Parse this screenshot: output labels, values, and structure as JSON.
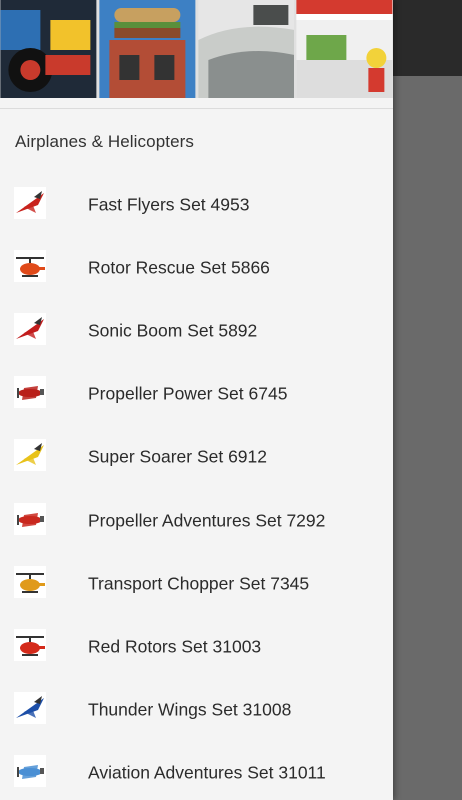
{
  "drawer": {
    "header_tiles": [
      {
        "name": "lego-vehicle-tile",
        "colors": [
          "#1f2a38",
          "#c93a2c",
          "#f2c22b",
          "#2d6fb3"
        ]
      },
      {
        "name": "lego-building-tile",
        "colors": [
          "#3d80c4",
          "#c7a060",
          "#b34d36",
          "#5a8f3b"
        ]
      },
      {
        "name": "lego-car-tile",
        "colors": [
          "#c9ccc9",
          "#8a8f8e",
          "#4a4d4c",
          "#e6e6e6"
        ]
      },
      {
        "name": "lego-market-tile",
        "colors": [
          "#d43a2f",
          "#f0f0f0",
          "#6ea74a",
          "#f2a33a"
        ]
      }
    ],
    "section_title": "Airplanes & Helicopters",
    "items": [
      {
        "label": "Fast Flyers Set 4953",
        "icon": "red-jet-icon",
        "color": "#c8231d"
      },
      {
        "label": "Rotor Rescue Set 5866",
        "icon": "helicopter-icon",
        "color": "#e04a1a"
      },
      {
        "label": "Sonic Boom Set 5892",
        "icon": "red-jet-icon",
        "color": "#c21d1d"
      },
      {
        "label": "Propeller Power Set 6745",
        "icon": "propeller-plane-icon",
        "color": "#b8201a"
      },
      {
        "label": "Super Soarer Set 6912",
        "icon": "yellow-plane-icon",
        "color": "#e8c21a"
      },
      {
        "label": "Propeller Adventures Set 7292",
        "icon": "propeller-plane-icon",
        "color": "#c9281f"
      },
      {
        "label": "Transport Chopper Set 7345",
        "icon": "helicopter-icon",
        "color": "#e09a1a"
      },
      {
        "label": "Red Rotors Set 31003",
        "icon": "helicopter-icon",
        "color": "#d42a1a"
      },
      {
        "label": "Thunder Wings Set 31008",
        "icon": "blue-jet-icon",
        "color": "#1d4fa8"
      },
      {
        "label": "Aviation Adventures Set 31011",
        "icon": "seaplane-icon",
        "color": "#4a8fd4"
      }
    ]
  }
}
